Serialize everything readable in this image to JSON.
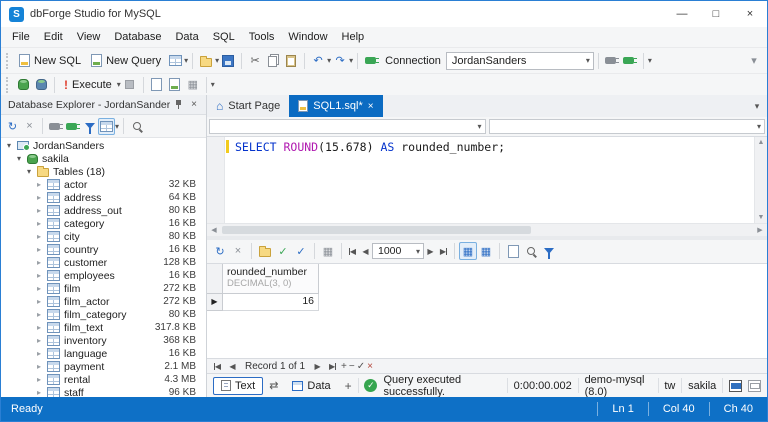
{
  "window": {
    "title": "dbForge Studio for MySQL"
  },
  "window_controls": {
    "minimize": "—",
    "maximize": "□",
    "close": "×"
  },
  "menu": {
    "items": [
      "File",
      "Edit",
      "View",
      "Database",
      "Data",
      "SQL",
      "Tools",
      "Window",
      "Help"
    ]
  },
  "icons": {
    "dropdown": "▾",
    "expand": "▸",
    "collapse": "▾",
    "refresh": "↻",
    "undo": "↶",
    "redo": "↷",
    "cut": "✂",
    "close": "×",
    "prev": "◀",
    "next": "▶",
    "swap": "⇄",
    "check": "✓",
    "minus": "−",
    "plus": "+",
    "home": "⌂",
    "grid": "▦",
    "exclaim": "!",
    "play": "▶"
  },
  "toolbar": {
    "new_sql": "New SQL",
    "new_query": "New Query",
    "connection_label": "Connection",
    "connection_value": "JordanSanders"
  },
  "toolbar2": {
    "execute_label": "Execute"
  },
  "explorer": {
    "title": "Database Explorer - JordanSanders",
    "root_label": "JordanSanders",
    "db_label": "sakila",
    "tables_label": "Tables (18)",
    "tables": [
      {
        "name": "actor",
        "size": "32 KB"
      },
      {
        "name": "address",
        "size": "64 KB"
      },
      {
        "name": "address_out",
        "size": "80 KB"
      },
      {
        "name": "category",
        "size": "16 KB"
      },
      {
        "name": "city",
        "size": "80 KB"
      },
      {
        "name": "country",
        "size": "16 KB"
      },
      {
        "name": "customer",
        "size": "128 KB"
      },
      {
        "name": "employees",
        "size": "16 KB"
      },
      {
        "name": "film",
        "size": "272 KB"
      },
      {
        "name": "film_actor",
        "size": "272 KB"
      },
      {
        "name": "film_category",
        "size": "80 KB"
      },
      {
        "name": "film_text",
        "size": "317.8 KB"
      },
      {
        "name": "inventory",
        "size": "368 KB"
      },
      {
        "name": "language",
        "size": "16 KB"
      },
      {
        "name": "payment",
        "size": "2.1 MB"
      },
      {
        "name": "rental",
        "size": "4.3 MB"
      },
      {
        "name": "staff",
        "size": "96 KB"
      }
    ]
  },
  "doc_tabs": {
    "start_page": "Start Page",
    "sql_tab": "SQL1.sql*"
  },
  "editor": {
    "kw1": "SELECT ",
    "fn": "ROUND",
    "open_paren": "(",
    "number": "15.678",
    "close_paren": ") ",
    "kw2": "AS ",
    "identifier": "rounded_number",
    "semicolon": ";"
  },
  "results": {
    "page_size": "1000",
    "column_name": "rounded_number",
    "column_type": "DECIMAL(3, 0)",
    "row_value": "16",
    "record_label": "Record 1 of 1"
  },
  "bottom_bar": {
    "text_tab": "Text",
    "data_tab": "Data",
    "plus": "+",
    "status": "Query executed successfully.",
    "time": "0:00:00.002",
    "server": "demo-mysql (8.0)",
    "user": "tw",
    "database": "sakila"
  },
  "statusbar": {
    "left": "Ready",
    "ln": "Ln 1",
    "col": "Col 40",
    "ch": "Ch 40"
  }
}
